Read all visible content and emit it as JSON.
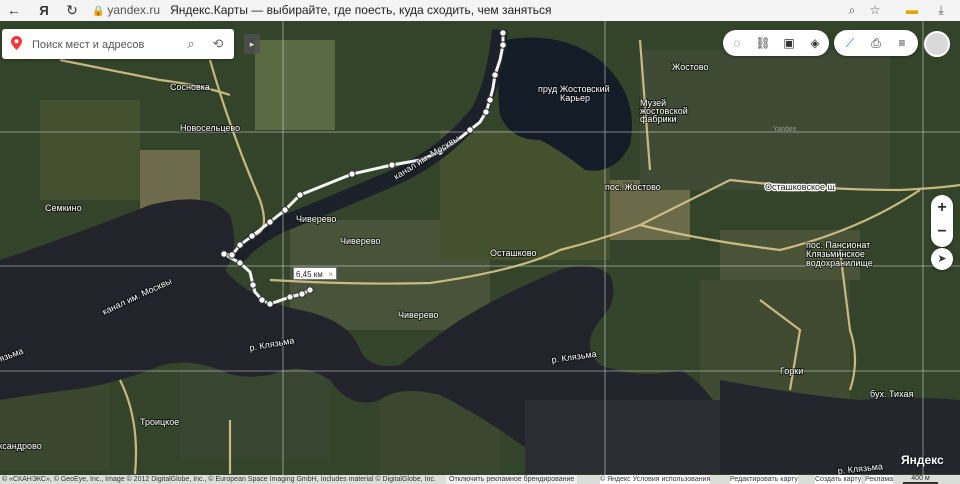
{
  "browser": {
    "back_icon": "←",
    "brand_icon": "Я",
    "reload_icon": "↻",
    "host": "yandex.ru",
    "page_title": "Яндекс.Карты — выбирайте, где поесть, куда сходить, чем заняться",
    "search_icon": "search-icon",
    "bookmark_icon": "bookmark-icon",
    "menu_icon": "menu-icon",
    "download_icon": "download-icon"
  },
  "search": {
    "placeholder": "Поиск мест и адресов",
    "search_icon": "⌕",
    "route_icon": "⟲",
    "collapse_icon": "▸"
  },
  "toolbar": {
    "traffic_icon": "◌",
    "panorama_icon": "⛓",
    "transport_icon": "▣",
    "layers_icon": "◈",
    "ruler_icon": "⟋",
    "print_icon": "⎙",
    "menu_icon": "≡"
  },
  "zoom": {
    "in": "+",
    "out": "−",
    "locate": "➤"
  },
  "route": {
    "distance": "6,45 км",
    "close": "×"
  },
  "map_labels": {
    "lake": "пруд Жостовский",
    "quarry": "Карьер",
    "museum_1": "Музей",
    "museum_2": "жостовской",
    "museum_3": "фабрики",
    "zhostovo": "Жостово",
    "pos_zhostovo": "пос. Жостово",
    "ostashkovskoe": "Осташковское ш",
    "sosnovka": "Сосновка",
    "novoseltsevo": "Новосельцево",
    "kanal_1": "канал им. Москвы",
    "kanal_2": "канал им. Москвы",
    "semkino": "Семкино",
    "chiverevo_1": "Чиверево",
    "chiverevo_2": "Чиверево",
    "chiverevo_3": "Чиверево",
    "ostashkovo": "Осташково",
    "pansionat_1": "пос. Пансионат",
    "pansionat_2": "Клязьминское",
    "pansionat_3": "водохранилище",
    "klyazma_1": "р. Клязьма",
    "klyazma_2": "р. Клязьма",
    "klyazma_3": "р. Клязьма",
    "klyazma_4": "р. Клязьма",
    "gorki": "Горки",
    "buhta": "бух. Тихая",
    "troitskoe": "Троицкое",
    "aleksandrovo": "Александрово",
    "yandex_wm": "Yandex"
  },
  "logo": "Яндекс",
  "footer": {
    "copyright": "© «СКАНЭКС», © GeoEye, Inc., Image © 2012 DigitalGlobe, Inc., © European Space Imaging GmbH, Includes material © DigitalGlobe, Inc.",
    "ad_disable": "Отключить рекламное брендирование",
    "yandex": "© Яндекс Условия использования",
    "edit": "Редактировать карту",
    "create": "Создать карту",
    "ads": "Реклама",
    "scale": "400 м"
  }
}
